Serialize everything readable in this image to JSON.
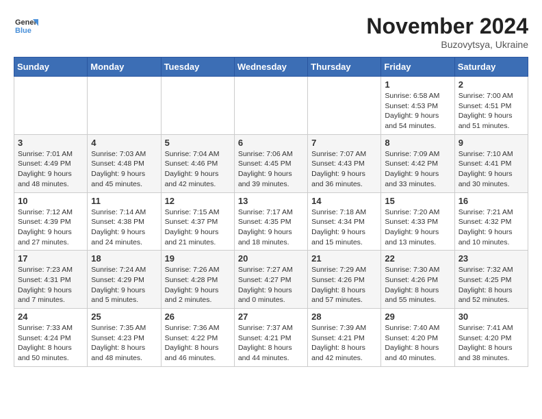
{
  "header": {
    "logo": {
      "line1": "General",
      "line2": "Blue"
    },
    "title": "November 2024",
    "location": "Buzovytsya, Ukraine"
  },
  "weekdays": [
    "Sunday",
    "Monday",
    "Tuesday",
    "Wednesday",
    "Thursday",
    "Friday",
    "Saturday"
  ],
  "weeks": [
    [
      {
        "day": "",
        "info": ""
      },
      {
        "day": "",
        "info": ""
      },
      {
        "day": "",
        "info": ""
      },
      {
        "day": "",
        "info": ""
      },
      {
        "day": "",
        "info": ""
      },
      {
        "day": "1",
        "info": "Sunrise: 6:58 AM\nSunset: 4:53 PM\nDaylight: 9 hours\nand 54 minutes."
      },
      {
        "day": "2",
        "info": "Sunrise: 7:00 AM\nSunset: 4:51 PM\nDaylight: 9 hours\nand 51 minutes."
      }
    ],
    [
      {
        "day": "3",
        "info": "Sunrise: 7:01 AM\nSunset: 4:49 PM\nDaylight: 9 hours\nand 48 minutes."
      },
      {
        "day": "4",
        "info": "Sunrise: 7:03 AM\nSunset: 4:48 PM\nDaylight: 9 hours\nand 45 minutes."
      },
      {
        "day": "5",
        "info": "Sunrise: 7:04 AM\nSunset: 4:46 PM\nDaylight: 9 hours\nand 42 minutes."
      },
      {
        "day": "6",
        "info": "Sunrise: 7:06 AM\nSunset: 4:45 PM\nDaylight: 9 hours\nand 39 minutes."
      },
      {
        "day": "7",
        "info": "Sunrise: 7:07 AM\nSunset: 4:43 PM\nDaylight: 9 hours\nand 36 minutes."
      },
      {
        "day": "8",
        "info": "Sunrise: 7:09 AM\nSunset: 4:42 PM\nDaylight: 9 hours\nand 33 minutes."
      },
      {
        "day": "9",
        "info": "Sunrise: 7:10 AM\nSunset: 4:41 PM\nDaylight: 9 hours\nand 30 minutes."
      }
    ],
    [
      {
        "day": "10",
        "info": "Sunrise: 7:12 AM\nSunset: 4:39 PM\nDaylight: 9 hours\nand 27 minutes."
      },
      {
        "day": "11",
        "info": "Sunrise: 7:14 AM\nSunset: 4:38 PM\nDaylight: 9 hours\nand 24 minutes."
      },
      {
        "day": "12",
        "info": "Sunrise: 7:15 AM\nSunset: 4:37 PM\nDaylight: 9 hours\nand 21 minutes."
      },
      {
        "day": "13",
        "info": "Sunrise: 7:17 AM\nSunset: 4:35 PM\nDaylight: 9 hours\nand 18 minutes."
      },
      {
        "day": "14",
        "info": "Sunrise: 7:18 AM\nSunset: 4:34 PM\nDaylight: 9 hours\nand 15 minutes."
      },
      {
        "day": "15",
        "info": "Sunrise: 7:20 AM\nSunset: 4:33 PM\nDaylight: 9 hours\nand 13 minutes."
      },
      {
        "day": "16",
        "info": "Sunrise: 7:21 AM\nSunset: 4:32 PM\nDaylight: 9 hours\nand 10 minutes."
      }
    ],
    [
      {
        "day": "17",
        "info": "Sunrise: 7:23 AM\nSunset: 4:31 PM\nDaylight: 9 hours\nand 7 minutes."
      },
      {
        "day": "18",
        "info": "Sunrise: 7:24 AM\nSunset: 4:29 PM\nDaylight: 9 hours\nand 5 minutes."
      },
      {
        "day": "19",
        "info": "Sunrise: 7:26 AM\nSunset: 4:28 PM\nDaylight: 9 hours\nand 2 minutes."
      },
      {
        "day": "20",
        "info": "Sunrise: 7:27 AM\nSunset: 4:27 PM\nDaylight: 9 hours\nand 0 minutes."
      },
      {
        "day": "21",
        "info": "Sunrise: 7:29 AM\nSunset: 4:26 PM\nDaylight: 8 hours\nand 57 minutes."
      },
      {
        "day": "22",
        "info": "Sunrise: 7:30 AM\nSunset: 4:26 PM\nDaylight: 8 hours\nand 55 minutes."
      },
      {
        "day": "23",
        "info": "Sunrise: 7:32 AM\nSunset: 4:25 PM\nDaylight: 8 hours\nand 52 minutes."
      }
    ],
    [
      {
        "day": "24",
        "info": "Sunrise: 7:33 AM\nSunset: 4:24 PM\nDaylight: 8 hours\nand 50 minutes."
      },
      {
        "day": "25",
        "info": "Sunrise: 7:35 AM\nSunset: 4:23 PM\nDaylight: 8 hours\nand 48 minutes."
      },
      {
        "day": "26",
        "info": "Sunrise: 7:36 AM\nSunset: 4:22 PM\nDaylight: 8 hours\nand 46 minutes."
      },
      {
        "day": "27",
        "info": "Sunrise: 7:37 AM\nSunset: 4:21 PM\nDaylight: 8 hours\nand 44 minutes."
      },
      {
        "day": "28",
        "info": "Sunrise: 7:39 AM\nSunset: 4:21 PM\nDaylight: 8 hours\nand 42 minutes."
      },
      {
        "day": "29",
        "info": "Sunrise: 7:40 AM\nSunset: 4:20 PM\nDaylight: 8 hours\nand 40 minutes."
      },
      {
        "day": "30",
        "info": "Sunrise: 7:41 AM\nSunset: 4:20 PM\nDaylight: 8 hours\nand 38 minutes."
      }
    ]
  ]
}
